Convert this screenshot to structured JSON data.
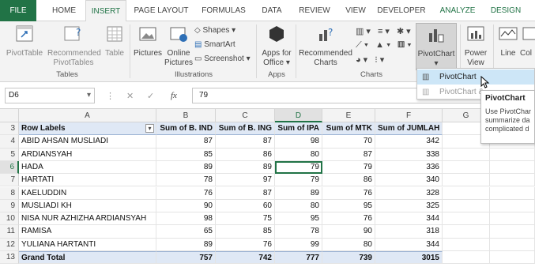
{
  "tabs": [
    {
      "label": "FILE"
    },
    {
      "label": "HOME"
    },
    {
      "label": "INSERT"
    },
    {
      "label": "PAGE LAYOUT"
    },
    {
      "label": "FORMULAS"
    },
    {
      "label": "DATA"
    },
    {
      "label": "REVIEW"
    },
    {
      "label": "VIEW"
    },
    {
      "label": "DEVELOPER"
    },
    {
      "label": "ANALYZE"
    },
    {
      "label": "DESIGN"
    }
  ],
  "ribbon": {
    "pivottable": "PivotTable",
    "recommended_pivot": [
      "Recommended",
      "PivotTables"
    ],
    "table": "Table",
    "pictures": "Pictures",
    "online_pictures": [
      "Online",
      "Pictures"
    ],
    "shapes": "Shapes ▾",
    "smartart": "SmartArt",
    "screenshot": "Screenshot ▾",
    "apps_for_office": [
      "Apps for",
      "Office ▾"
    ],
    "recommended_charts": [
      "Recommended",
      "Charts"
    ],
    "pivotchart": "PivotChart",
    "power_view": [
      "Power",
      "View"
    ],
    "line": "Line",
    "col": "Col",
    "groups": {
      "tables": "Tables",
      "illustrations": "Illustrations",
      "apps": "Apps",
      "charts": "Charts"
    }
  },
  "formula_bar": {
    "name_box": "D6",
    "fx": "fx",
    "value": "79"
  },
  "columns": [
    "A",
    "B",
    "C",
    "D",
    "E",
    "F",
    "G"
  ],
  "selected_column": "D",
  "selected_row": "6",
  "pivot": {
    "header": [
      "Row Labels",
      "Sum of B. IND",
      "Sum of B. ING",
      "Sum of IPA",
      "Sum of MTK",
      "Sum of JUMLAH"
    ],
    "rows": [
      {
        "n": "4",
        "label": "ABID AHSAN MUSLIADI",
        "v": [
          "87",
          "87",
          "98",
          "70",
          "342"
        ]
      },
      {
        "n": "5",
        "label": "ARDIANSYAH",
        "v": [
          "85",
          "86",
          "80",
          "87",
          "338"
        ]
      },
      {
        "n": "6",
        "label": "HADA",
        "v": [
          "89",
          "89",
          "79",
          "79",
          "336"
        ]
      },
      {
        "n": "7",
        "label": "HARTATI",
        "v": [
          "78",
          "97",
          "79",
          "86",
          "340"
        ]
      },
      {
        "n": "8",
        "label": "KAELUDDIN",
        "v": [
          "76",
          "87",
          "89",
          "76",
          "328"
        ]
      },
      {
        "n": "9",
        "label": "MUSLIADI KH",
        "v": [
          "90",
          "60",
          "80",
          "95",
          "325"
        ]
      },
      {
        "n": "10",
        "label": "NISA NUR AZHIZHA ARDIANSYAH",
        "v": [
          "98",
          "75",
          "95",
          "76",
          "344"
        ]
      },
      {
        "n": "11",
        "label": "RAMISA",
        "v": [
          "65",
          "85",
          "78",
          "90",
          "318"
        ]
      },
      {
        "n": "12",
        "label": "YULIANA HARTANTI",
        "v": [
          "89",
          "76",
          "99",
          "80",
          "344"
        ]
      }
    ],
    "total": {
      "n": "13",
      "label": "Grand Total",
      "v": [
        "757",
        "742",
        "777",
        "739",
        "3015"
      ]
    },
    "header_row_num": "3"
  },
  "dropdown": {
    "items": [
      "PivotChart",
      "PivotChart &"
    ]
  },
  "tooltip": {
    "title": "PivotChart",
    "lines": [
      "Use PivotChar",
      "summarize da",
      "complicated d"
    ]
  }
}
